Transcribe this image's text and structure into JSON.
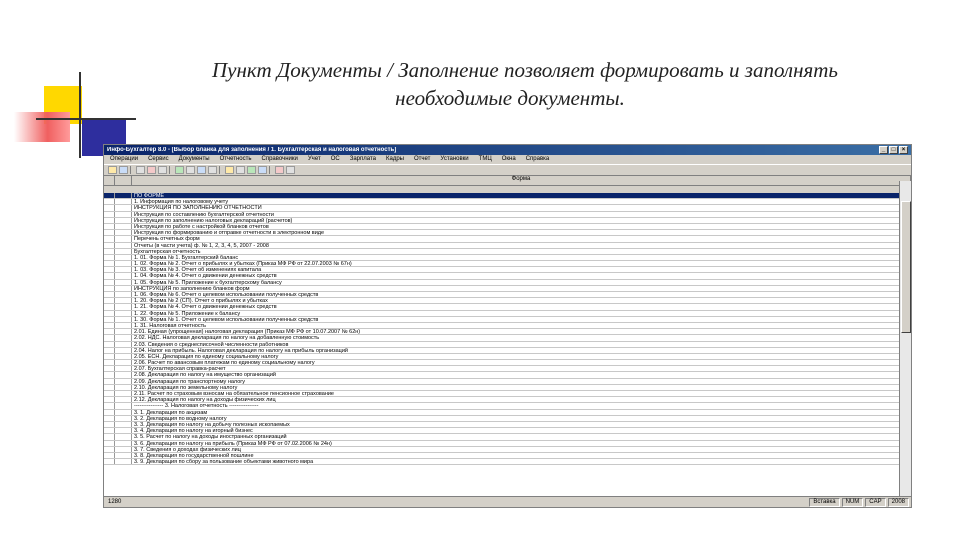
{
  "slide": {
    "title_line1": "Пункт Документы / Заполнение позволяет формировать и заполнять",
    "title_line2": "необходимые документы."
  },
  "window": {
    "title": "Инфо-Бухгалтер 8.0 - [Выбор бланка для заполнения / 1. Бухгалтерская и налоговая отчетность]",
    "menu": [
      "Операции",
      "Сервис",
      "Документы",
      "Отчетность",
      "Справочники",
      "Учет",
      "ОС",
      "Зарплата",
      "Кадры",
      "Отчет",
      "Установки",
      "ТМЦ",
      "Окна",
      "Справка"
    ],
    "column_header": "Форма",
    "rows": [
      "ПО ФОРМЕ",
      "1. Информация по налоговому учету",
      "ИНСТРУКЦИЯ ПО ЗАПОЛНЕНИЮ ОТЧЕТНОСТИ",
      "Инструкция по составлению бухгалтерской отчетности",
      "Инструкция по заполнению налоговых деклараций (расчетов)",
      "Инструкция по работе с настройкой бланков отчетов",
      "Инструкция по формированию и отправке отчетности в электронном виде",
      "Перечень отчетных форм",
      "Отчеты (в части учета) ф. № 1, 2, 3, 4, 5, 2007 - 2008",
      "                Бухгалтерская отчетность",
      "1. 01. Форма № 1. Бухгалтерский баланс",
      "1. 02. Форма № 2. Отчет о прибылях и убытках (Приказ МФ РФ от 22.07.2003 № 67н)",
      "1. 03. Форма № 3. Отчет об изменениях капитала",
      "1. 04. Форма № 4. Отчет о движении денежных средств",
      "1. 05. Форма № 5. Приложение к бухгалтерскому балансу",
      "   ИНСТРУКЦИЯ по заполнению бланков форм",
      "1. 06. Форма № 6. Отчет о целевом использовании полученных средств",
      "1. 20. Форма № 2 (СП). Отчет о прибылях и убытках",
      "1. 21. Форма № 4. Отчет о движении денежных средств",
      "1. 22. Форма № 5. Приложение к балансу",
      "1. 30. Форма № 1. Отчет о целевом использовании полученных средств",
      "1. 31. Налоговая отчетность",
      "2.01. Единая (упрощенная) налоговая декларация (Приказ МФ РФ от 10.07.2007 № 62н)",
      "2.02. НДС. Налоговая декларация по налогу на добавленную стоимость",
      "2.03. Сведения о среднесписочной численности работников",
      "2.04. Налог на прибыль. Налоговая декларация по налогу на прибыль организаций",
      "2.05. ЕСН. Декларация по единому социальному налогу",
      "2.06. Расчет по авансовым платежам по единому социальному налогу",
      "2.07. Бухгалтерская справка-расчет",
      "2.08. Декларация по налогу на имущество организаций",
      "2.09. Декларация по транспортному налогу",
      "2.10. Декларация по земельному налогу",
      "2.11. Расчет по страховым взносам на обязательное пенсионное страхование",
      "2.12. Декларация по налогу на доходы физических лиц",
      "---------------- 3. Налоговая отчетность ----------------",
      "3. 1. Декларация по акцизам",
      "3. 2. Декларация по водному налогу",
      "3. 3. Декларация по налогу на добычу полезных ископаемых",
      "3. 4. Декларация по налогу на игорный бизнес",
      "3. 5. Расчет по налогу на доходы иностранных организаций",
      "3. 6. Декларация по налогу на прибыль (Приказ МФ РФ от 07.02.2006 № 24н)",
      "3. 7. Сведения о доходах физических лиц",
      "3. 8. Декларация по государственной пошлине",
      "3. 9. Декларация по сбору за пользование объектами животного мира"
    ],
    "status": {
      "left": "1280",
      "panes": [
        "Вставка",
        "NUM",
        "CAP",
        "2008"
      ]
    }
  }
}
